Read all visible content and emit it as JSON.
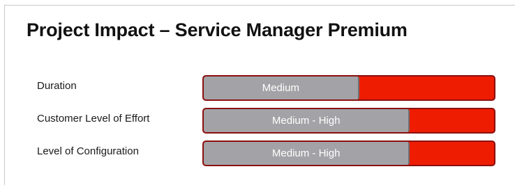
{
  "title": "Project Impact – Service Manager Premium",
  "colors": {
    "filled": "#a3a3a7",
    "remaining": "#ee1c00",
    "text": "#1a1a1a"
  },
  "rows": [
    {
      "label": "Duration",
      "value_text": "Medium",
      "fill_fraction": 0.535
    },
    {
      "label": "Customer Level of Effort",
      "value_text": "Medium - High",
      "fill_fraction": 0.71
    },
    {
      "label": "Level of Configuration",
      "value_text": "Medium - High",
      "fill_fraction": 0.71
    }
  ]
}
